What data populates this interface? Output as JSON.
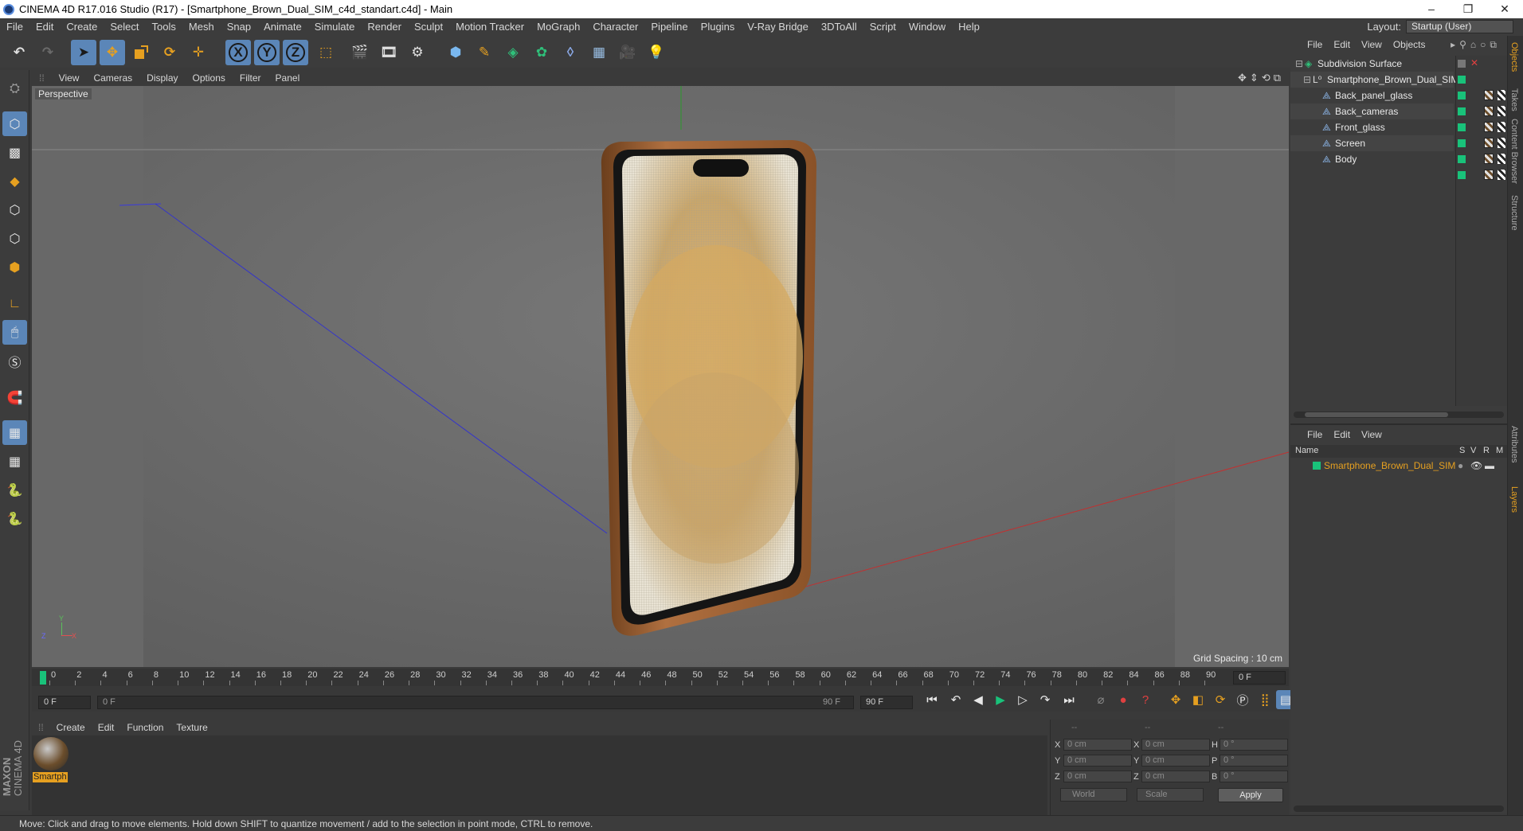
{
  "window": {
    "title": "CINEMA 4D R17.016 Studio (R17) - [Smartphone_Brown_Dual_SIM_c4d_standart.c4d] - Main",
    "controls": [
      "–",
      "❐",
      "✕"
    ]
  },
  "menubar": {
    "items": [
      "File",
      "Edit",
      "Create",
      "Select",
      "Tools",
      "Mesh",
      "Snap",
      "Animate",
      "Simulate",
      "Render",
      "Sculpt",
      "Motion Tracker",
      "MoGraph",
      "Character",
      "Pipeline",
      "Plugins",
      "V-Ray Bridge",
      "3DToAll",
      "Script",
      "Window",
      "Help"
    ],
    "layout_label": "Layout:",
    "layout_value": "Startup (User)"
  },
  "toolbar": {
    "axis_x": "X",
    "axis_y": "Y",
    "axis_z": "Z"
  },
  "viewport": {
    "menu": [
      "View",
      "Cameras",
      "Display",
      "Options",
      "Filter",
      "Panel"
    ],
    "label": "Perspective",
    "grid_spacing": "Grid Spacing : 10 cm",
    "axis_gizmo": {
      "y": "Y",
      "z": "Z",
      "x": "X"
    }
  },
  "timeline": {
    "ticks": [
      "0",
      "2",
      "4",
      "6",
      "8",
      "10",
      "12",
      "14",
      "16",
      "18",
      "20",
      "22",
      "24",
      "26",
      "28",
      "30",
      "32",
      "34",
      "36",
      "38",
      "40",
      "42",
      "44",
      "46",
      "48",
      "50",
      "52",
      "54",
      "56",
      "58",
      "60",
      "62",
      "64",
      "66",
      "68",
      "70",
      "72",
      "74",
      "76",
      "78",
      "80",
      "82",
      "84",
      "86",
      "88",
      "90"
    ],
    "end_frame": "0 F",
    "start_field": "0 F",
    "range_start": "0 F",
    "range_end": "90 F",
    "max_field": "90 F"
  },
  "material_manager": {
    "menu": [
      "Create",
      "Edit",
      "Function",
      "Texture"
    ],
    "materials": [
      {
        "name": "Smartph"
      }
    ]
  },
  "coordinates": {
    "headers": [
      "--",
      "--",
      "--"
    ],
    "rows": [
      {
        "l1": "X",
        "v1": "0 cm",
        "l2": "X",
        "v2": "0 cm",
        "l3": "H",
        "v3": "0 °"
      },
      {
        "l1": "Y",
        "v1": "0 cm",
        "l2": "Y",
        "v2": "0 cm",
        "l3": "P",
        "v3": "0 °"
      },
      {
        "l1": "Z",
        "v1": "0 cm",
        "l2": "Z",
        "v2": "0 cm",
        "l3": "B",
        "v3": "0 °"
      }
    ],
    "world": "World",
    "scale": "Scale",
    "apply": "Apply"
  },
  "object_manager": {
    "menu": [
      "File",
      "Edit",
      "View",
      "Objects"
    ],
    "objects": [
      {
        "name": "Subdivision Surface"
      },
      {
        "name": "Smartphone_Brown_Dual_SIM"
      },
      {
        "name": "Back_panel_glass"
      },
      {
        "name": "Back_cameras"
      },
      {
        "name": "Front_glass"
      },
      {
        "name": "Screen"
      },
      {
        "name": "Body"
      }
    ]
  },
  "layer_manager": {
    "menu": [
      "File",
      "Edit",
      "View"
    ],
    "columns": [
      "Name",
      "S",
      "V",
      "R",
      "M"
    ],
    "layers": [
      {
        "name": "Smartphone_Brown_Dual_SIM",
        "color": "#19c27a"
      }
    ]
  },
  "side_tabs": [
    "Objects",
    "Takes",
    "Content Browser",
    "Structure",
    "Attributes",
    "Layers"
  ],
  "status": "Move: Click and drag to move elements. Hold down SHIFT to quantize movement / add to the selection in point mode, CTRL to remove.",
  "brand": {
    "line1": "MAXON",
    "line2": "CINEMA 4D"
  },
  "colors": {
    "accent": "#e6a020",
    "selected": "#5b86b8",
    "layer_green": "#19c27a"
  }
}
